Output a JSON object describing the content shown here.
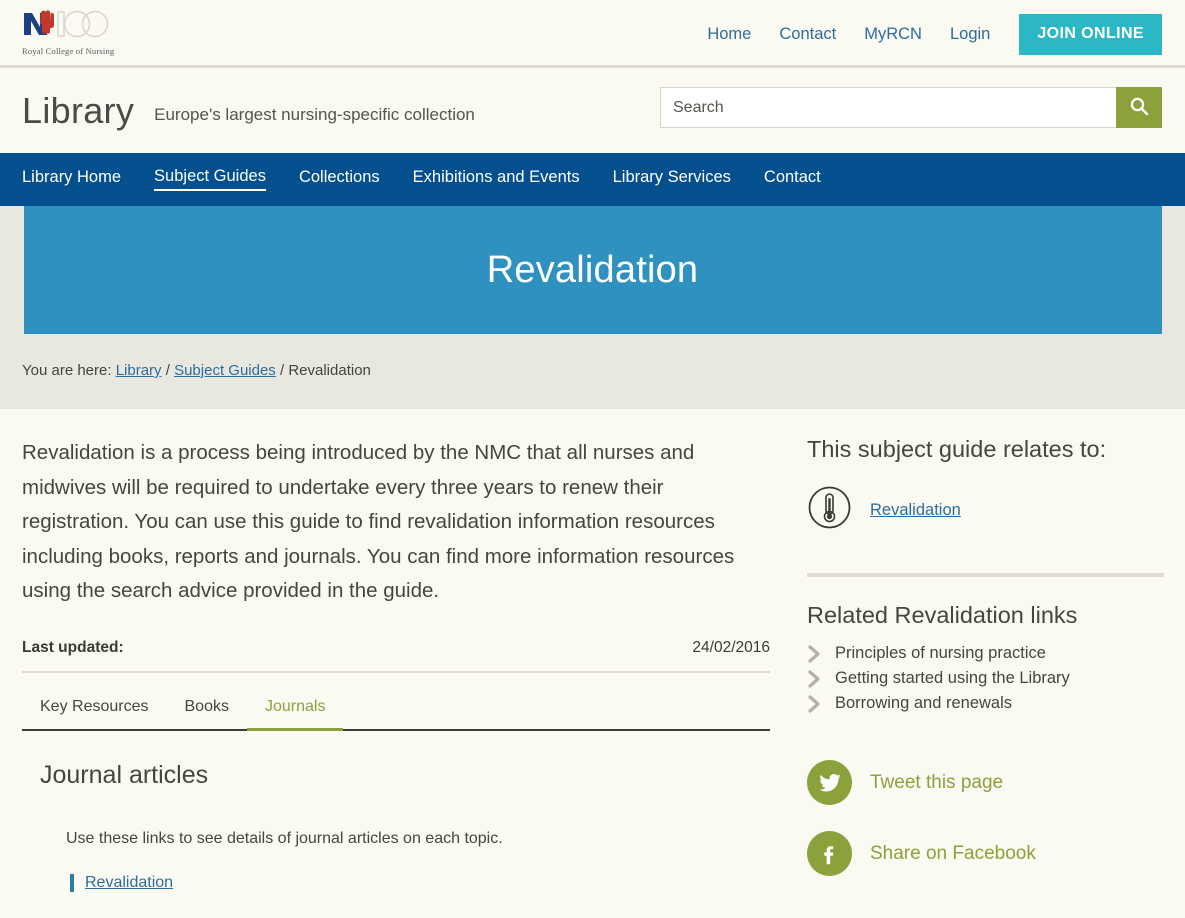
{
  "brand": {
    "logo_name": "rcn-100-logo",
    "logo_caption": "Royal College of Nursing",
    "accent_teal": "#2bb8c4",
    "accent_blue": "#04508f",
    "accent_olive": "#8ba23c",
    "hero_blue": "#2e91bf",
    "link_blue": "#2f6c9e"
  },
  "topnav": {
    "links": [
      {
        "label": "Home"
      },
      {
        "label": "Contact"
      },
      {
        "label": "MyRCN"
      },
      {
        "label": "Login"
      }
    ],
    "join_label": "JOIN ONLINE"
  },
  "masthead": {
    "title": "Library",
    "tagline": "Europe's largest nursing-specific collection"
  },
  "search": {
    "placeholder": "Search",
    "value": "",
    "button_icon": "search-icon"
  },
  "mainnav": {
    "items": [
      {
        "label": "Library Home",
        "active": false
      },
      {
        "label": "Subject Guides",
        "active": true
      },
      {
        "label": "Collections",
        "active": false
      },
      {
        "label": "Exhibitions and Events",
        "active": false
      },
      {
        "label": "Library Services",
        "active": false
      },
      {
        "label": "Contact",
        "active": false
      }
    ]
  },
  "hero": {
    "title": "Revalidation"
  },
  "breadcrumb": {
    "prefix": "You are here:",
    "item1": "Library",
    "sep1": "/",
    "item2": "Subject Guides",
    "sep2": "/",
    "current": "Revalidation"
  },
  "main": {
    "lede": "Revalidation is a process being introduced by the NMC that all nurses and midwives will be required to undertake every three years to renew their registration. You can use this guide to find revalidation information resources including books, reports and journals. You can find more information resources using the search advice provided in the guide.",
    "updated_label": "Last updated:",
    "updated_date": "24/02/2016",
    "tabs": [
      {
        "label": "Key Resources",
        "active": false
      },
      {
        "label": "Books",
        "active": false
      },
      {
        "label": "Journals",
        "active": true
      }
    ],
    "panel": {
      "title": "Journal articles",
      "note": "Use these links to see details of journal articles on each topic.",
      "link_label": "Revalidation"
    }
  },
  "sidebar": {
    "relates_heading": "This subject guide relates to:",
    "relates_icon": "thermometer-icon",
    "relates_link": "Revalidation",
    "related_heading": "Related Revalidation links",
    "related_links": [
      {
        "label": "Principles of nursing practice"
      },
      {
        "label": "Getting started using the Library"
      },
      {
        "label": "Borrowing and renewals"
      }
    ],
    "social": [
      {
        "icon": "twitter-icon",
        "label": "Tweet this page"
      },
      {
        "icon": "facebook-icon",
        "label": "Share on Facebook"
      }
    ]
  }
}
